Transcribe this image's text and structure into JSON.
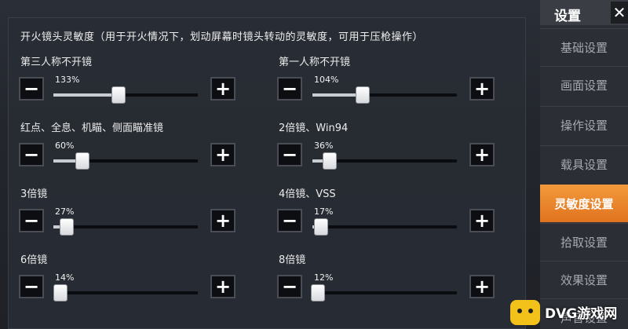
{
  "section_title": "开火镜头灵敏度（用于开火情况下，划动屏幕时镜头转动的灵敏度，可用于压枪操作）",
  "sliders": [
    {
      "label": "第三人称不开镜",
      "value_text": "133%",
      "fraction": 0.45
    },
    {
      "label": "第一人称不开镜",
      "value_text": "104%",
      "fraction": 0.35
    },
    {
      "label": "红点、全息、机瞄、侧面瞄准镜",
      "value_text": "60%",
      "fraction": 0.2
    },
    {
      "label": "2倍镜、Win94",
      "value_text": "36%",
      "fraction": 0.12
    },
    {
      "label": "3倍镜",
      "value_text": "27%",
      "fraction": 0.09
    },
    {
      "label": "4倍镜、VSS",
      "value_text": "17%",
      "fraction": 0.06
    },
    {
      "label": "6倍镜",
      "value_text": "14%",
      "fraction": 0.05
    },
    {
      "label": "8倍镜",
      "value_text": "12%",
      "fraction": 0.04
    }
  ],
  "buttons": {
    "minus": "−",
    "plus": "+"
  },
  "menu": {
    "title": "设置",
    "close": "✕",
    "items": [
      {
        "label": "基础设置",
        "active": false
      },
      {
        "label": "画面设置",
        "active": false
      },
      {
        "label": "操作设置",
        "active": false
      },
      {
        "label": "载具设置",
        "active": false
      },
      {
        "label": "灵敏度设置",
        "active": true
      },
      {
        "label": "拾取设置",
        "active": false
      },
      {
        "label": "效果设置",
        "active": false
      },
      {
        "label": "声音设置",
        "active": false
      }
    ]
  },
  "watermark": {
    "text": "DVG游戏网"
  },
  "colors": {
    "accent": "#f0882c",
    "track": "#0b0c0f",
    "fill": "#c9ccd1"
  }
}
